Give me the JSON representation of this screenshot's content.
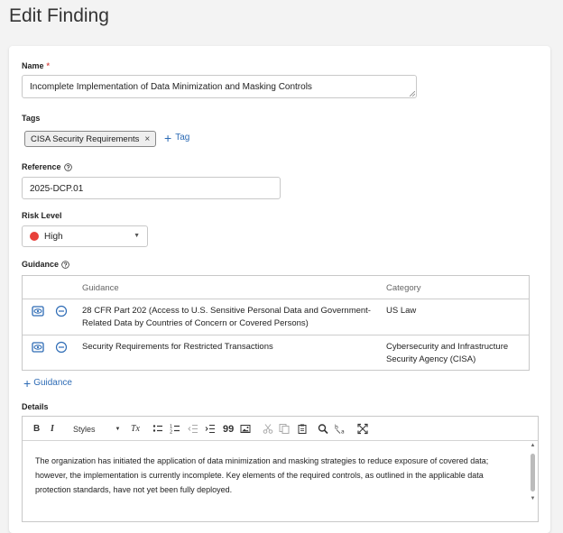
{
  "page": {
    "title": "Edit Finding"
  },
  "name": {
    "label": "Name",
    "required_mark": "*",
    "value": "Incomplete Implementation of Data Minimization and Masking Controls"
  },
  "tags": {
    "label": "Tags",
    "items": [
      {
        "label": "CISA Security Requirements",
        "remove": "×"
      }
    ],
    "add_label": "Tag"
  },
  "reference": {
    "label": "Reference",
    "value": "2025-DCP.01"
  },
  "risk": {
    "label": "Risk Level",
    "value": "High",
    "color": "#e8403a"
  },
  "guidance": {
    "label": "Guidance",
    "columns": [
      "Guidance",
      "Category"
    ],
    "rows": [
      {
        "guidance_line1": "28 CFR Part 202 (Access to U.S. Sensitive Personal Data and Government-",
        "guidance_line2": "Related Data by Countries of Concern or Covered Persons)",
        "category_line1": "US Law",
        "category_line2": ""
      },
      {
        "guidance_line1": "Security Requirements for Restricted Transactions",
        "guidance_line2": "",
        "category_line1": "Cybersecurity and Infrastructure",
        "category_line2": "Security Agency (CISA)"
      }
    ],
    "add_label": "Guidance"
  },
  "details": {
    "label": "Details",
    "toolbar": {
      "bold": "B",
      "italic": "I",
      "styles": "Styles",
      "clear_format": "Tx",
      "quote": "99"
    },
    "text": "The organization has initiated the application of data minimization and masking strategies to reduce exposure of covered data; however, the implementation is currently incomplete. Key elements of the required controls, as outlined in the applicable data protection standards, have not yet been fully deployed."
  },
  "colors": {
    "accent": "#2d6bb5",
    "danger": "#e8403a"
  }
}
